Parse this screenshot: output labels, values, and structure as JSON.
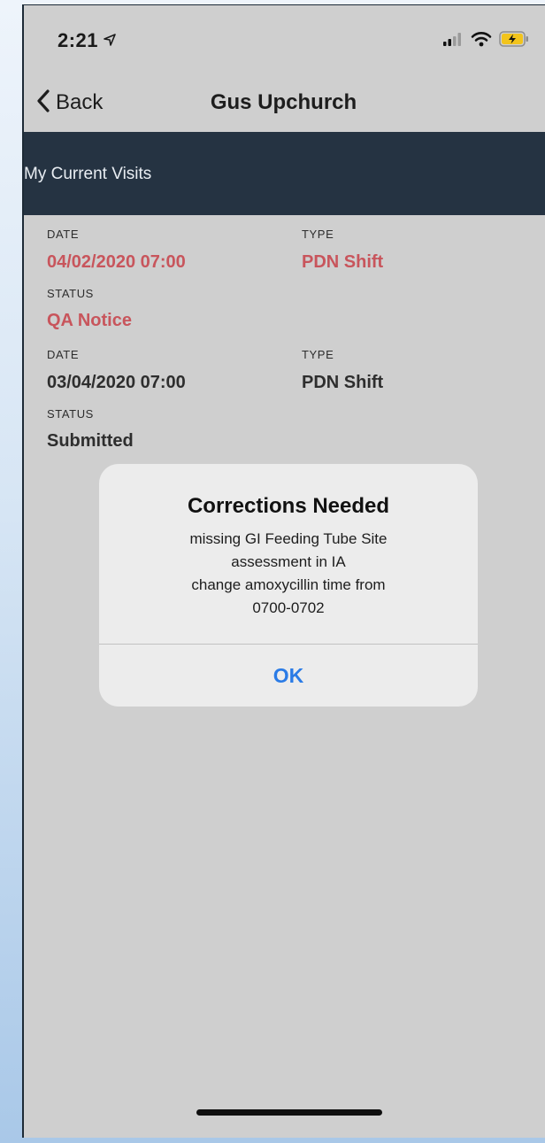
{
  "status_bar": {
    "time": "2:21",
    "icons": [
      "location-arrow-icon",
      "signal-icon",
      "wifi-icon",
      "battery-charging-icon"
    ],
    "battery_color": "#f2c41c"
  },
  "nav": {
    "back_label": "Back",
    "title": "Gus Upchurch"
  },
  "section": {
    "label": "My Current Visits"
  },
  "visits": [
    {
      "date_label": "DATE",
      "date": "04/02/2020 07:00",
      "type_label": "TYPE",
      "type": "PDN Shift",
      "status_label": "STATUS",
      "status": "QA Notice",
      "highlight_color": "#c8555c"
    },
    {
      "date_label": "DATE",
      "date": "03/04/2020 07:00",
      "type_label": "TYPE",
      "type": "PDN Shift",
      "status_label": "STATUS",
      "status": "Submitted"
    }
  ],
  "dialog": {
    "title": "Corrections Needed",
    "message_lines": [
      "missing GI Feeding Tube Site",
      "assessment in IA",
      "change amoxycillin time from",
      "0700-0702"
    ],
    "button_label": "OK",
    "button_color": "#2a7be6"
  }
}
